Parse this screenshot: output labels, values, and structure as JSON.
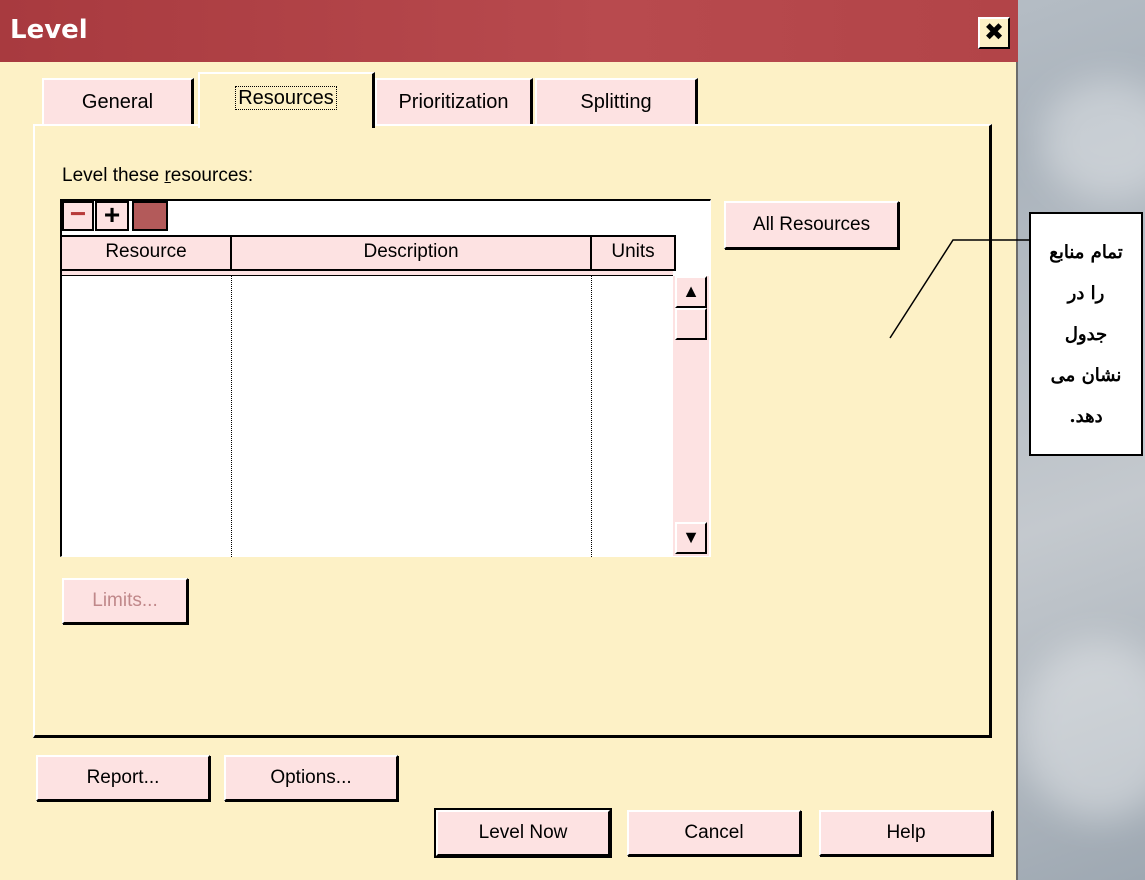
{
  "window": {
    "title": "Level",
    "close_glyph": "✖"
  },
  "tabs": [
    {
      "label": "General",
      "active": false
    },
    {
      "label": "Resources",
      "active": true
    },
    {
      "label": "Prioritization",
      "active": false
    },
    {
      "label": "Splitting",
      "active": false
    }
  ],
  "resources": {
    "label_prefix": "Level these ",
    "label_accel": "r",
    "label_suffix": "esources:",
    "toolbar": {
      "minus": "−",
      "plus": "+"
    },
    "columns": [
      "Resource",
      "Description",
      "Units"
    ],
    "rows": [],
    "all_resources_label": "All Resources",
    "limits_label": "Limits...",
    "scroll_up": "▲",
    "scroll_down": "▼"
  },
  "footer": {
    "report_label": "Report...",
    "options_label": "Options...",
    "level_now_label": "Level Now",
    "cancel_label": "Cancel",
    "help_label": "Help"
  },
  "callout": {
    "lines": [
      "تمام منابع",
      "را در",
      "جدول",
      "نشان می",
      "دهد."
    ]
  },
  "colors": {
    "title_bar": "#a83a3f",
    "dialog_bg": "#fdf1c6",
    "button_bg": "#fde2e2"
  }
}
